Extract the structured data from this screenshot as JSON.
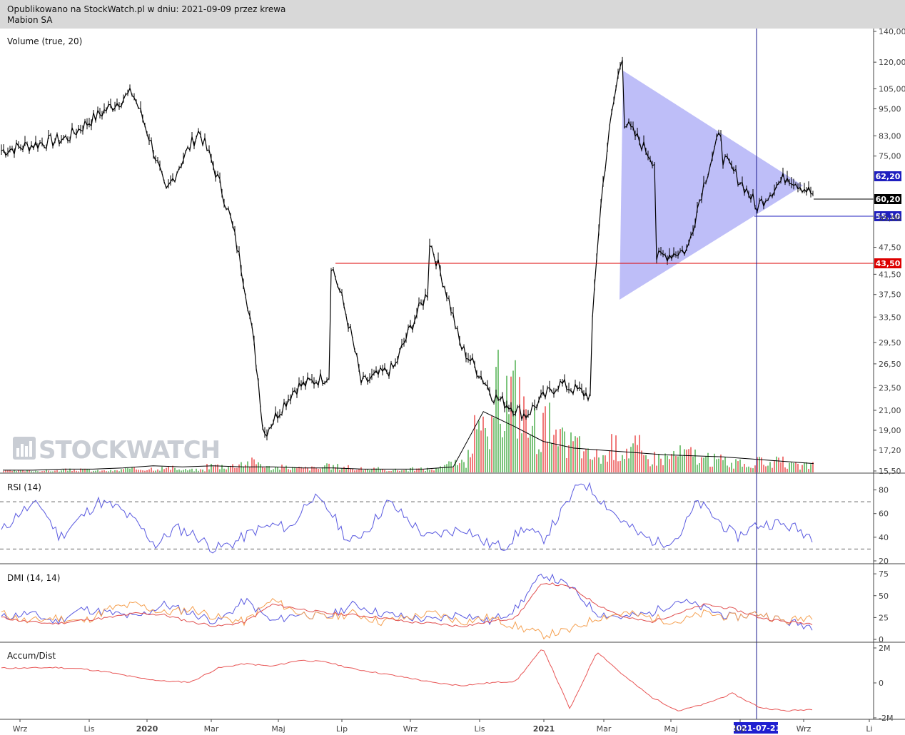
{
  "header": {
    "line1": "Opublikowano na StockWatch.pl w dniu: 2021-09-09 przez krewa",
    "line2": "Mabion SA"
  },
  "watermark": "STOCKWATCH",
  "colors": {
    "price": "#000000",
    "volume_up": "#7cc47c",
    "volume_down": "#f07a7a",
    "rsi": "#5a5ae0",
    "dmi_plus": "#5a5ae0",
    "dmi_minus": "#f5a050",
    "adx": "#e05050",
    "accum": "#e85555",
    "triangle": "#b7b7f7",
    "support": "#dd0000",
    "crosshair": "#1a1a8c"
  },
  "chart_data": [
    {
      "type": "line",
      "pane": "price",
      "title": "Volume (true, 20)",
      "y_ticks": [
        "140,00",
        "120,00",
        "105,00",
        "95,00",
        "83,00",
        "75,00",
        "62,20",
        "60,20",
        "55,10",
        "55,00",
        "47,50",
        "43,50",
        "41,50",
        "37,50",
        "33,50",
        "29,50",
        "26,50",
        "23,50",
        "21,00",
        "19,00",
        "17,20",
        "15,50"
      ],
      "ylim": [
        15.5,
        140
      ],
      "y_scale": "log",
      "x_ticks": [
        "Wrz",
        "Lis",
        "2020",
        "Mar",
        "Maj",
        "Lip",
        "Wrz",
        "Lis",
        "2021",
        "Mar",
        "Maj",
        "Lip",
        "Wrz",
        "Li"
      ],
      "series": [
        {
          "x": [
            "2019-08",
            "2019-10",
            "2019-12",
            "2020-01",
            "2020-02",
            "2020-03",
            "2020-04",
            "2020-05",
            "2020-06",
            "2020-06",
            "2020-07",
            "2020-08",
            "2020-09",
            "2020-09",
            "2020-10",
            "2020-11",
            "2020-12",
            "2021-01",
            "2021-02",
            "2021-02",
            "2021-03",
            "2021-03",
            "2021-04",
            "2021-04",
            "2021-05",
            "2021-06",
            "2021-06",
            "2021-07",
            "2021-07",
            "2021-08",
            "2021-09"
          ],
          "values": [
            77,
            82,
            103,
            62,
            85,
            55,
            18.5,
            23.5,
            25,
            45,
            24,
            26,
            38,
            50,
            29,
            22.5,
            20.5,
            24,
            22.5,
            32,
            125,
            90,
            72,
            45,
            47,
            85,
            75,
            60,
            57,
            68,
            60.2
          ]
        }
      ],
      "annotations": [
        {
          "label": "62,20",
          "value": 62.2,
          "color": "#1f1fbf"
        },
        {
          "label": "60,20",
          "value": 60.2,
          "color": "#000000"
        },
        {
          "label": "55,10",
          "value": 55.1,
          "color": "#1f1fbf"
        },
        {
          "label": "43,50",
          "value": 43.5,
          "color": "#dd0000"
        }
      ],
      "crosshair_date": "2021-07-21"
    },
    {
      "type": "bar",
      "pane": "volume",
      "values_relative": [
        0.02,
        0.02,
        0.03,
        0.02,
        0.04,
        0.05,
        0.03,
        0.08,
        0.12,
        0.06,
        0.05,
        0.07,
        0.04,
        0.03,
        0.04,
        0.1,
        0.45,
        0.95,
        0.55,
        0.35,
        0.2,
        0.3,
        0.18,
        0.22,
        0.15,
        0.1,
        0.12,
        0.08
      ],
      "ma_relative": [
        0.02,
        0.02,
        0.03,
        0.03,
        0.04,
        0.06,
        0.05,
        0.06,
        0.05,
        0.05,
        0.04,
        0.04,
        0.03,
        0.03,
        0.03,
        0.05,
        0.55,
        0.42,
        0.28,
        0.22,
        0.2,
        0.18,
        0.16,
        0.15,
        0.14,
        0.12,
        0.1,
        0.08
      ]
    },
    {
      "type": "line",
      "pane": "rsi",
      "title": "RSI (14)",
      "y_ticks": [
        "80",
        "60",
        "40",
        "20"
      ],
      "ylim": [
        20,
        90
      ],
      "series": [
        {
          "values": [
            45,
            62,
            68,
            40,
            55,
            70,
            65,
            52,
            33,
            48,
            42,
            30,
            35,
            45,
            50,
            48,
            75,
            62,
            35,
            48,
            70,
            55,
            40,
            44,
            48,
            35,
            32,
            48,
            38,
            62,
            88,
            72,
            55,
            42,
            35,
            40,
            70,
            55,
            40,
            50,
            52,
            48,
            40
          ]
        }
      ]
    },
    {
      "type": "line",
      "pane": "dmi",
      "title": "DMI (14, 14)",
      "y_ticks": [
        "75",
        "50",
        "25",
        "0"
      ],
      "ylim": [
        0,
        80
      ],
      "series": [
        {
          "name": "+DI",
          "values": [
            25,
            30,
            20,
            35,
            30,
            25,
            40,
            30,
            20,
            45,
            20,
            30,
            25,
            40,
            30,
            25,
            22,
            30,
            20,
            35,
            75,
            60,
            30,
            25,
            30,
            45,
            35,
            25,
            30,
            20,
            15
          ]
        },
        {
          "name": "-DI",
          "values": [
            30,
            20,
            25,
            20,
            35,
            40,
            30,
            35,
            25,
            20,
            45,
            30,
            25,
            30,
            20,
            25,
            30,
            20,
            25,
            15,
            5,
            10,
            25,
            30,
            25,
            20,
            30,
            25,
            30,
            20,
            28
          ]
        },
        {
          "name": "ADX",
          "values": [
            25,
            20,
            18,
            22,
            25,
            30,
            28,
            20,
            15,
            20,
            40,
            35,
            30,
            28,
            25,
            20,
            18,
            15,
            20,
            25,
            65,
            60,
            40,
            25,
            20,
            30,
            40,
            35,
            25,
            20,
            18
          ]
        }
      ]
    },
    {
      "type": "line",
      "pane": "accum",
      "title": "Accum/Dist",
      "y_ticks": [
        "2M",
        "0",
        "-2M"
      ],
      "ylim": [
        -2,
        2
      ],
      "series": [
        {
          "values": [
            0.85,
            0.85,
            0.88,
            0.8,
            0.6,
            0.3,
            0.1,
            0.05,
            0.85,
            1.1,
            0.95,
            1.3,
            1.2,
            0.8,
            0.55,
            0.3,
            0.0,
            -0.15,
            0.0,
            0.1,
            2.0,
            -1.5,
            1.8,
            0.4,
            -0.8,
            -1.6,
            -1.2,
            -0.6,
            -1.4,
            -1.6,
            -1.5
          ]
        }
      ]
    }
  ]
}
